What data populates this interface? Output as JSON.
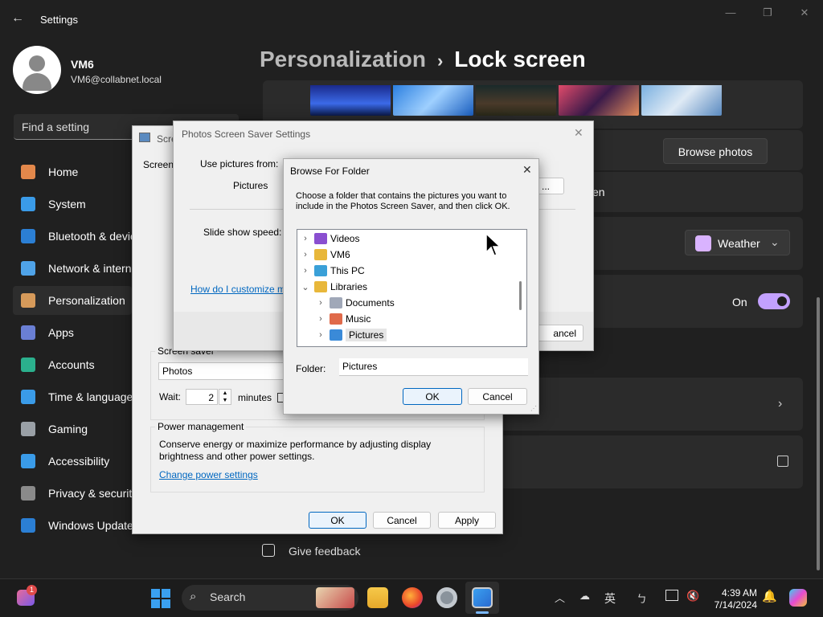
{
  "settings": {
    "title": "Settings",
    "user": {
      "name": "VM6",
      "email": "VM6@collabnet.local"
    },
    "search_placeholder": "Find a setting",
    "nav": [
      {
        "label": "Home",
        "color": "#e3884b"
      },
      {
        "label": "System",
        "color": "#3a9be8"
      },
      {
        "label": "Bluetooth & devices",
        "color": "#2b7fd4"
      },
      {
        "label": "Network & internet",
        "color": "#4fa3e8"
      },
      {
        "label": "Personalization",
        "color": "#d69a5a"
      },
      {
        "label": "Apps",
        "color": "#6a7fd4"
      },
      {
        "label": "Accounts",
        "color": "#2bb08d"
      },
      {
        "label": "Time & language",
        "color": "#3a9be8"
      },
      {
        "label": "Gaming",
        "color": "#9aa0a6"
      },
      {
        "label": "Accessibility",
        "color": "#3a9be8"
      },
      {
        "label": "Privacy & security",
        "color": "#8a8a8a"
      },
      {
        "label": "Windows Update",
        "color": "#2b7fd4"
      }
    ],
    "breadcrumb_parent": "Personalization",
    "breadcrumb_current": "Lock screen",
    "browse_photos": "Browse photos",
    "partial_screen_text": "en",
    "weather_label": "Weather",
    "toggle_label": "On",
    "give_feedback": "Give feedback",
    "accent_color": "#c3a1ff"
  },
  "screen_saver": {
    "title": "Scre",
    "side_label": "Screen S",
    "group_label": "Screen saver",
    "selected": "Photos",
    "wait_label": "Wait:",
    "wait_value": "2",
    "minutes_label": "minutes",
    "power_group": "Power management",
    "power_text": "Conserve energy or maximize performance by adjusting display brightness and other power settings.",
    "power_link": "Change power settings",
    "ok": "OK",
    "cancel": "Cancel",
    "apply": "Apply"
  },
  "photos_settings": {
    "title": "Photos Screen Saver Settings",
    "use_pictures": "Use pictures from:",
    "pictures": "Pictures",
    "browse_partial": "...",
    "speed_label": "Slide show speed:",
    "help_link": "How do I customize m",
    "cancel_partial": "ancel"
  },
  "browse_folder": {
    "title": "Browse For Folder",
    "instruction": "Choose a folder that contains the pictures you want to include in the Photos Screen Saver, and then click OK.",
    "tree": [
      {
        "label": "Videos",
        "chev": "›",
        "color": "#8a4fd0",
        "indent": 0
      },
      {
        "label": "VM6",
        "chev": "›",
        "color": "#e8b73a",
        "indent": 0
      },
      {
        "label": "This PC",
        "chev": "›",
        "color": "#3aa0d8",
        "indent": 0
      },
      {
        "label": "Libraries",
        "chev": "⌄",
        "color": "#e8b73a",
        "indent": 0
      },
      {
        "label": "Documents",
        "chev": "›",
        "color": "#a0a8b8",
        "indent": 1
      },
      {
        "label": "Music",
        "chev": "›",
        "color": "#e06a4a",
        "indent": 1
      },
      {
        "label": "Pictures",
        "chev": "›",
        "color": "#3a8ad8",
        "indent": 1,
        "selected": true
      }
    ],
    "folder_label": "Folder:",
    "folder_value": "Pictures",
    "ok": "OK",
    "cancel": "Cancel"
  },
  "taskbar": {
    "search": "Search",
    "ime": "英",
    "time": "4:39 AM",
    "date": "7/14/2024",
    "badge": "1"
  }
}
